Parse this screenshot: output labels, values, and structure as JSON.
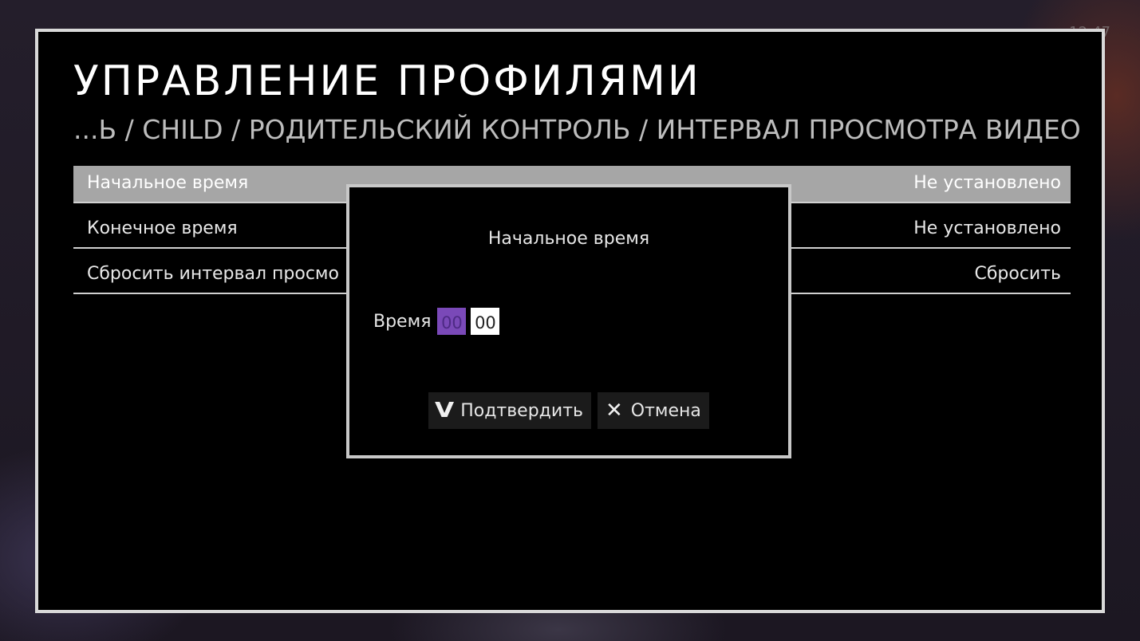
{
  "screen": {
    "clock": "12:47"
  },
  "header": {
    "title": "УПРАВЛЕНИЕ ПРОФИЛЯМИ",
    "breadcrumb": "...Ь / CHILD / РОДИТЕЛЬСКИЙ КОНТРОЛЬ / ИНТЕРВАЛ ПРОСМОТРА ВИДЕО"
  },
  "settings": {
    "rows": [
      {
        "label": "Начальное время",
        "value": "Не установлено",
        "selected": true
      },
      {
        "label": "Конечное время",
        "value": "Не установлено",
        "selected": false
      },
      {
        "label": "Сбросить интервал просмо",
        "value": "Сбросить",
        "selected": false
      }
    ]
  },
  "dialog": {
    "title": "Начальное время",
    "time_label": "Время",
    "hours": "00",
    "minutes": "00",
    "confirm_label": "Подтвердить",
    "confirm_icon": "check-v-icon",
    "cancel_label": "Отмена",
    "cancel_icon": "close-x-icon"
  },
  "colors": {
    "panel_bg": "#000000",
    "panel_border": "#d9d9d9",
    "selected_row": "#a6a6a6",
    "active_field": "#7a49b8",
    "inactive_field": "#ffffff"
  }
}
